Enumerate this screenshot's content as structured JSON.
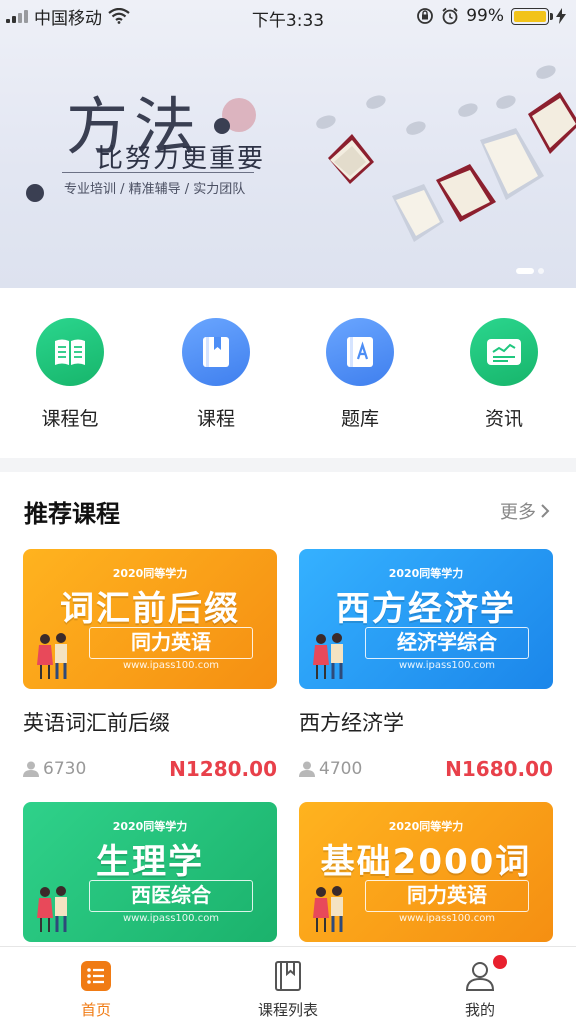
{
  "status_bar": {
    "carrier": "中国移动",
    "time": "下午3:33",
    "battery": "99%",
    "battery_level": 0.99
  },
  "banner": {
    "title": "方法",
    "subtitle": "比努力更重要",
    "tags": "专业培训 / 精准辅导 / 实力团队",
    "pages": 2,
    "active_page": 1
  },
  "quick_links": [
    {
      "label": "课程包",
      "icon": "book-open-icon",
      "color": "#1fc77e"
    },
    {
      "label": "课程",
      "icon": "bookmark-book-icon",
      "color": "#4d8ef5"
    },
    {
      "label": "题库",
      "icon": "question-bank-icon",
      "color": "#4d8ef5"
    },
    {
      "label": "资讯",
      "icon": "news-icon",
      "color": "#1fc77e"
    }
  ],
  "recommend": {
    "heading": "推荐课程",
    "more": "更多",
    "courses": [
      {
        "title": "英语词汇前后缀",
        "students": "6730",
        "price": "N1280.00",
        "banner_year": "2020同等学力",
        "banner_big": "词汇前后缀",
        "banner_sub": "同力英语",
        "banner_url": "www.ipass100.com",
        "color": "#fba21c"
      },
      {
        "title": "西方经济学",
        "students": "4700",
        "price": "N1680.00",
        "banner_year": "2020同等学力",
        "banner_big": "西方经济学",
        "banner_sub": "经济学综合",
        "banner_url": "www.ipass100.com",
        "color": "#2a9cf3"
      },
      {
        "banner_year": "2020同等学力",
        "banner_big": "生理学",
        "banner_sub": "西医综合",
        "banner_url": "www.ipass100.com",
        "color": "#24c47c"
      },
      {
        "banner_year": "2020同等学力",
        "banner_big": "基础2000词",
        "banner_sub": "同力英语",
        "banner_url": "www.ipass100.com",
        "color": "#fba21c"
      }
    ]
  },
  "tabbar": {
    "tabs": [
      {
        "label": "首页",
        "icon": "home-list-icon",
        "active": true
      },
      {
        "label": "课程列表",
        "icon": "course-list-icon",
        "active": false
      },
      {
        "label": "我的",
        "icon": "user-icon",
        "active": false
      }
    ],
    "active_color": "#f07b14"
  }
}
